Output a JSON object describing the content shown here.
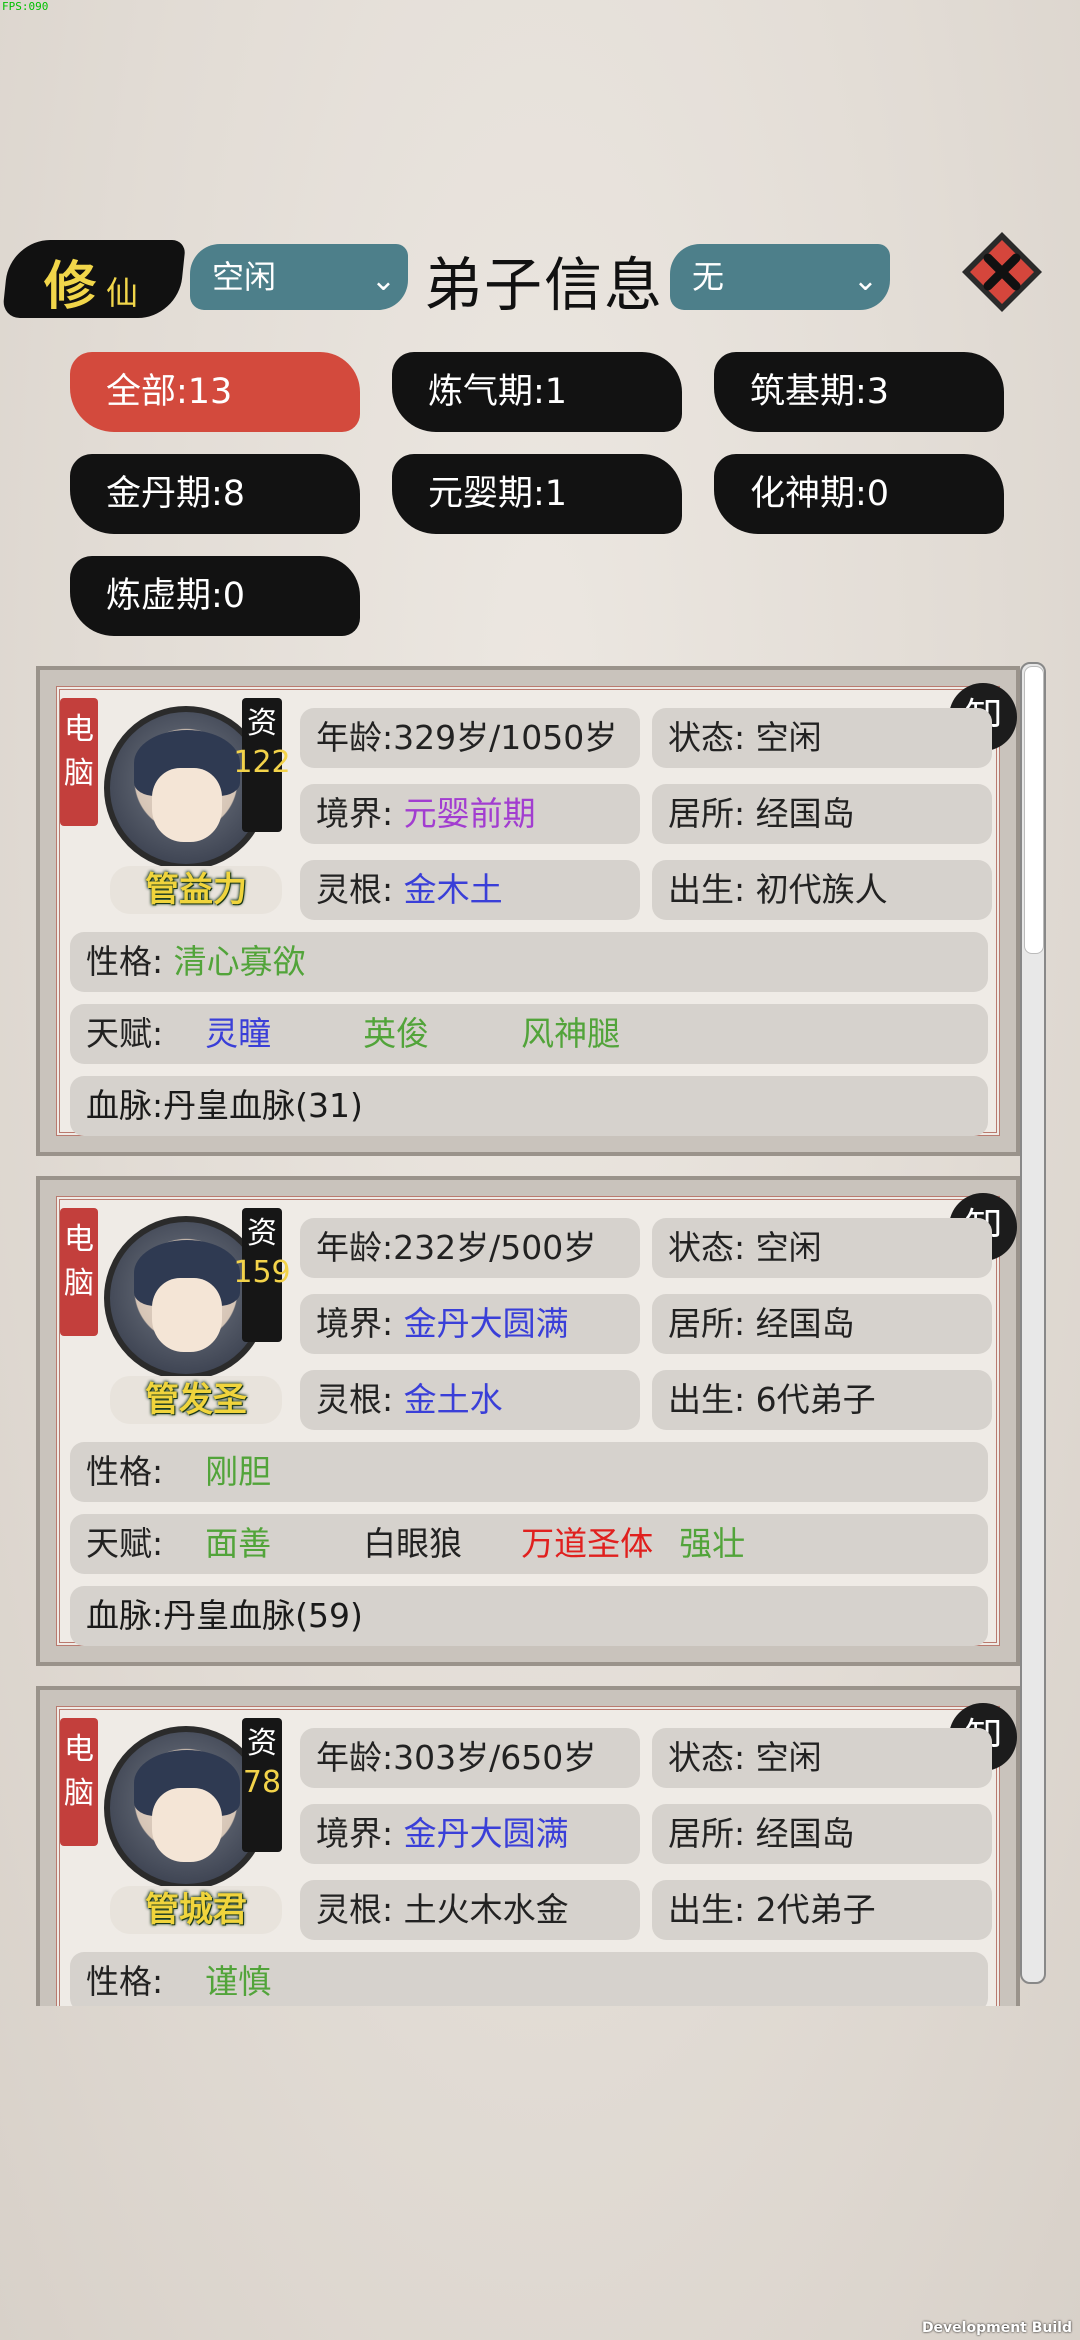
{
  "debug": {
    "fps": "FPS:090",
    "build": "Development Build"
  },
  "header": {
    "logo_main": "修",
    "logo_sub": "仙",
    "status_dropdown": "空闲",
    "title": "弟子信息",
    "filter_dropdown": "无"
  },
  "filters": [
    {
      "label": "全部:13",
      "active": true
    },
    {
      "label": "炼气期:1",
      "active": false
    },
    {
      "label": "筑基期:3",
      "active": false
    },
    {
      "label": "金丹期:8",
      "active": false
    },
    {
      "label": "元婴期:1",
      "active": false
    },
    {
      "label": "化神期:0",
      "active": false
    },
    {
      "label": "炼虚期:0",
      "active": false
    }
  ],
  "labels": {
    "age": "年龄:",
    "status": "状态:",
    "realm": "境界:",
    "residence": "居所:",
    "root": "灵根:",
    "origin": "出生:",
    "personality": "性格:",
    "talent": "天赋:",
    "robot": "电脑",
    "aptitude": "资",
    "seal": "卸"
  },
  "disciples": [
    {
      "name": "管益力",
      "aptitude": "122",
      "age": "329岁/1050岁",
      "status": "空闲",
      "realm": "元婴前期",
      "realm_color": "#a23dd0",
      "residence": "经国岛",
      "root": "金木土",
      "root_color": "#3a3fd8",
      "origin": "初代族人",
      "personality": "清心寡欲",
      "talents": [
        {
          "text": "灵瞳",
          "color": "#3a3fd8"
        },
        {
          "text": "英俊",
          "color": "#52a43a"
        },
        {
          "text": "风神腿",
          "color": "#52a43a"
        }
      ],
      "bloodline": "血脉:丹皇血脉(31)"
    },
    {
      "name": "管发圣",
      "aptitude": "159",
      "age": "232岁/500岁",
      "status": "空闲",
      "realm": "金丹大圆满",
      "realm_color": "#3a3fd8",
      "residence": "经国岛",
      "root": "金土水",
      "root_color": "#3a3fd8",
      "origin": "6代弟子",
      "personality": "刚胆",
      "talents": [
        {
          "text": "面善",
          "color": "#52a43a"
        },
        {
          "text": "白眼狼",
          "color": "#222222"
        },
        {
          "text": "万道圣体",
          "color": "#e0201e"
        },
        {
          "text": "强壮",
          "color": "#52a43a"
        }
      ],
      "bloodline": "血脉:丹皇血脉(59)"
    },
    {
      "name": "管城君",
      "aptitude": "78",
      "age": "303岁/650岁",
      "status": "空闲",
      "realm": "金丹大圆满",
      "realm_color": "#3a3fd8",
      "residence": "经国岛",
      "root": "土火木水金",
      "root_color": "#222222",
      "origin": "2代弟子",
      "personality": "谨慎",
      "talents": [],
      "bloodline": ""
    }
  ]
}
